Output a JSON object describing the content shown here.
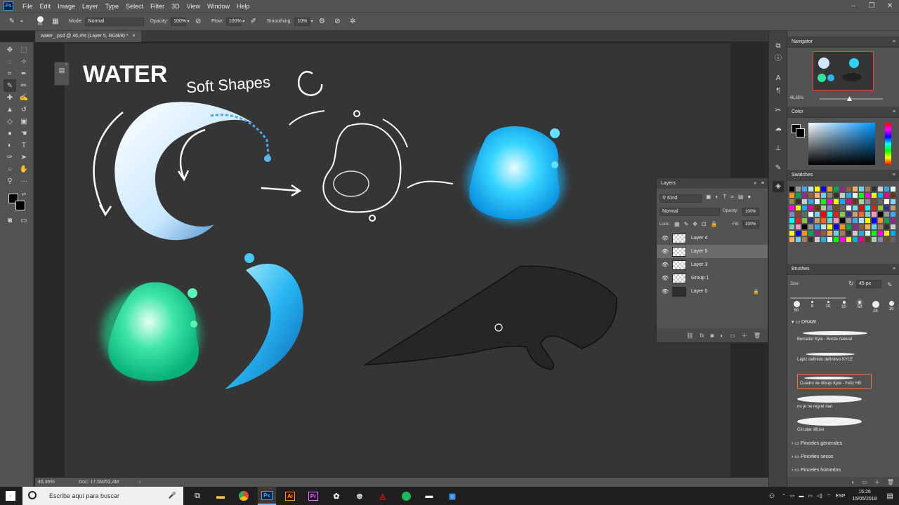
{
  "app": {
    "logo": "Ps"
  },
  "menu": [
    "File",
    "Edit",
    "Image",
    "Layer",
    "Type",
    "Select",
    "Filter",
    "3D",
    "View",
    "Window",
    "Help"
  ],
  "window_controls": [
    "–",
    "❐",
    "✕"
  ],
  "options": {
    "brush_size": "45",
    "mode_label": "Mode:",
    "mode_value": "Normal",
    "opacity_label": "Opacity:",
    "opacity_value": "100%",
    "flow_label": "Flow:",
    "flow_value": "100%",
    "smoothing_label": "Smoothing:",
    "smoothing_value": "10%"
  },
  "document": {
    "tab_title": "water_.psd @ 46,4% (Layer 5, RGB/8) *",
    "close": "×"
  },
  "canvas_text": {
    "title": "WATER",
    "subtitle": "Soft Shapes"
  },
  "status": {
    "zoom": "46,35%",
    "doc": "Doc: 17,5M/52,4M",
    "arrow": "›"
  },
  "navigator": {
    "title": "Navigator",
    "zoom": "46,35%"
  },
  "color_panel": {
    "title": "Color"
  },
  "swatches": {
    "title": "Swatches",
    "colors": [
      "#000000",
      "#333333",
      "#666666",
      "#999999",
      "#cccccc",
      "#ffffff",
      "#3fa9f5",
      "#29abe2",
      "#7fd3f7",
      "#b3e5fc",
      "#e1f5fe",
      "#ff0000",
      "#ffff00",
      "#00ff00",
      "#00ffff",
      "#0000ff",
      "#ff00ff",
      "#ed1c24",
      "#f7941d",
      "#fff200",
      "#8dc63f",
      "#00a651",
      "#00aeef",
      "#2e3192",
      "#92278f",
      "#ec008c",
      "#c69c6d",
      "#8c6239",
      "#603913",
      "#f26522",
      "#fbaf5d",
      "#a3d39c",
      "#7accc8",
      "#6dcff6",
      "#8781bd",
      "#f49ac2",
      "#a67c52",
      "#754c24"
    ]
  },
  "brushes": {
    "title": "Brushes",
    "size_label": "Size:",
    "size_value": "45 px",
    "tips": [
      "60",
      "8",
      "10",
      "10",
      "50",
      "25",
      "19"
    ],
    "folder_draw": "DRAW",
    "items": [
      "Borrador Kyle - Borde natural",
      "Lápiz definido definitivo KYLE",
      "Cuadro de dibujo Kyle - Feliz HB",
      "no je ne regret rian",
      "Circular difuso"
    ],
    "folders": [
      "Pinceles generales",
      "Pinceles secos",
      "Pinceles húmedos"
    ]
  },
  "layers": {
    "title": "Layers",
    "kind": "Kind",
    "blend": "Normal",
    "opacity_label": "Opacity:",
    "opacity_value": "100%",
    "lock_label": "Lock:",
    "fill_label": "Fill:",
    "fill_value": "100%",
    "rows": [
      "Layer 4",
      "Layer 5",
      "Layer 3",
      "Group 1",
      "Layer 0"
    ]
  },
  "taskbar": {
    "search_placeholder": "Escribe aquí para buscar",
    "apps": [
      "Ps",
      "Ai",
      "Pr"
    ],
    "lang": "ESP",
    "time": "15:26",
    "date": "15/05/2018"
  }
}
